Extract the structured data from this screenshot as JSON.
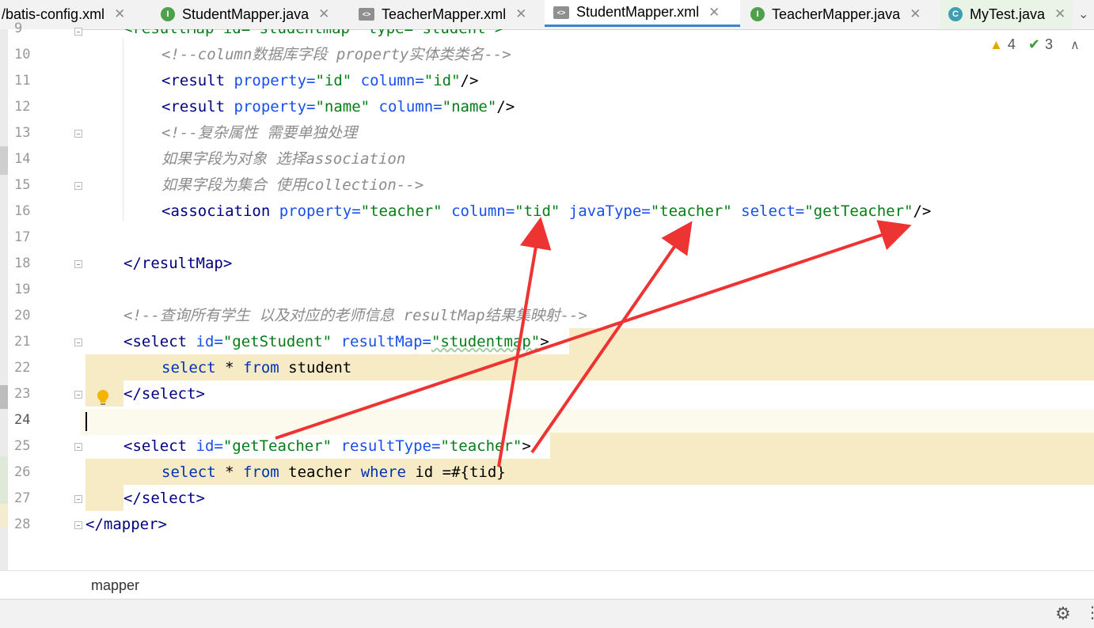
{
  "tabs": [
    {
      "label": "batis-config.xml",
      "prefix": "/",
      "icon": "xml-file-icon",
      "active": false
    },
    {
      "label": "StudentMapper.java",
      "icon": "interface-icon",
      "active": false
    },
    {
      "label": "TeacherMapper.xml",
      "icon": "xml-file-icon",
      "active": false
    },
    {
      "label": "StudentMapper.xml",
      "icon": "xml-file-icon",
      "active": true
    },
    {
      "label": "TeacherMapper.java",
      "icon": "interface-icon",
      "active": false
    },
    {
      "label": "MyTest.java",
      "icon": "class-icon",
      "active": false
    }
  ],
  "tab_close_glyph": "✕",
  "tab_overflow_glyph": "⌄",
  "inspections": {
    "warnings": "4",
    "weak_warnings": "3"
  },
  "line_numbers": [
    "9",
    "10",
    "11",
    "12",
    "13",
    "14",
    "15",
    "16",
    "17",
    "18",
    "19",
    "20",
    "21",
    "22",
    "23",
    "24",
    "25",
    "26",
    "27",
    "28"
  ],
  "code": {
    "l9": {
      "p1": "<resultMap id=\"studentmap\" type=\"student\">"
    },
    "l10": {
      "text": "<!--column数据库字段 property实体类类名-->"
    },
    "l11": {
      "open": "<result",
      "a1": " property=",
      "v1": "\"id\"",
      "a2": " column=",
      "v2": "\"id\"",
      "close": "/>"
    },
    "l12": {
      "open": "<result",
      "a1": " property=",
      "v1": "\"name\"",
      "a2": " column=",
      "v2": "\"name\"",
      "close": "/>"
    },
    "l13": {
      "text": "<!--复杂属性 需要单独处理"
    },
    "l14": {
      "text": "如果字段为对象 选择association"
    },
    "l15": {
      "text": "如果字段为集合 使用collection-->"
    },
    "l16": {
      "open": "<association",
      "a1": " property=",
      "v1": "\"teacher\"",
      "a2": " column=",
      "v2": "\"tid\"",
      "a3": " javaType=",
      "v3": "\"teacher\"",
      "a4": " select=",
      "v4": "\"getTeacher\"",
      "close": "/>"
    },
    "l18": {
      "text": "</resultMap>"
    },
    "l20": {
      "text": "<!--查询所有学生 以及对应的老师信息 resultMap结果集映射-->"
    },
    "l21": {
      "open": "<select",
      "a1": " id=",
      "v1": "\"getStudent\"",
      "a2": " resultMap=",
      "v2": "\"studentmap\"",
      "close": ">"
    },
    "l22": {
      "k1": "select",
      "p1": " * ",
      "k2": "from",
      "p2": " student"
    },
    "l23": {
      "text": "</select>"
    },
    "l25": {
      "open": "<select",
      "a1": " id=",
      "v1": "\"getTeacher\"",
      "a2": " resultType=",
      "v2": "\"teacher\"",
      "close": ">"
    },
    "l26": {
      "k1": "select",
      "p1": " * ",
      "k2": "from",
      "p2": " teacher ",
      "k3": "where",
      "p3": " id =#{tid}"
    },
    "l27": {
      "text": "</select>"
    },
    "l28": {
      "text": "</mapper>"
    }
  },
  "breadcrumb": "mapper",
  "colors": {
    "annotation_arrow": "#ee3333",
    "tab_active_underline": "#4083c9",
    "highlight": "#f6ebc5"
  }
}
